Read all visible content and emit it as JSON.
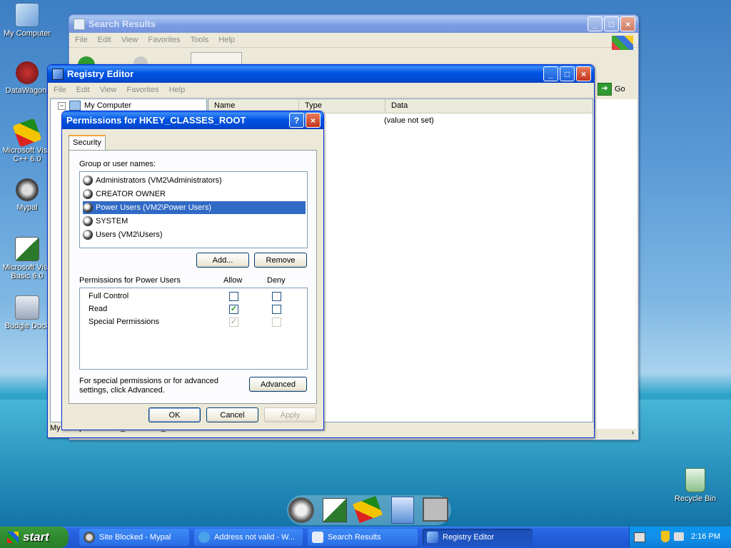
{
  "desktop": {
    "icons": [
      {
        "label": "My Computer"
      },
      {
        "label": "DataWagon."
      },
      {
        "label": "Microsoft Visu C++ 6.0"
      },
      {
        "label": "Mypal"
      },
      {
        "label": "Microsoft Visu Basic 6.0"
      },
      {
        "label": "Budgie Dock"
      },
      {
        "label": "Recycle Bin"
      }
    ]
  },
  "search_window": {
    "title": "Search Results",
    "menu": [
      "File",
      "Edit",
      "View",
      "Favorites",
      "Tools",
      "Help"
    ],
    "go_label": "Go"
  },
  "registry_window": {
    "title": "Registry Editor",
    "menu": [
      "File",
      "Edit",
      "View",
      "Favorites",
      "Help"
    ],
    "tree_root": "My Computer",
    "columns": [
      "Name",
      "Type",
      "Data"
    ],
    "row_data": "(value not set)",
    "status": "My Computer\\HKEY_CLASSES_ROOT"
  },
  "dialog": {
    "title": "Permissions for HKEY_CLASSES_ROOT",
    "help_glyph": "?",
    "tab": "Security",
    "group_label": "Group or user names:",
    "users": [
      {
        "name": "Administrators (VM2\\Administrators)",
        "selected": false
      },
      {
        "name": "CREATOR OWNER",
        "selected": false
      },
      {
        "name": "Power Users (VM2\\Power Users)",
        "selected": true
      },
      {
        "name": "SYSTEM",
        "selected": false
      },
      {
        "name": "Users (VM2\\Users)",
        "selected": false
      }
    ],
    "add_label": "Add...",
    "remove_label": "Remove",
    "perm_header": "Permissions for Power Users",
    "allow_header": "Allow",
    "deny_header": "Deny",
    "permissions": [
      {
        "name": "Full Control",
        "allow": false,
        "deny": false,
        "dim": false
      },
      {
        "name": "Read",
        "allow": true,
        "deny": false,
        "dim": false
      },
      {
        "name": "Special Permissions",
        "allow": true,
        "deny": false,
        "dim": true
      }
    ],
    "advanced_text": "For special permissions or for advanced settings, click Advanced.",
    "advanced_label": "Advanced",
    "ok_label": "OK",
    "cancel_label": "Cancel",
    "apply_label": "Apply"
  },
  "taskbar": {
    "start_label": "start",
    "tasks": [
      {
        "label": "Site Blocked - Mypal",
        "active": false
      },
      {
        "label": "Address not valid - W...",
        "active": false
      },
      {
        "label": "Search Results",
        "active": false
      },
      {
        "label": "Registry Editor",
        "active": true
      }
    ],
    "clock": "2:16 PM"
  },
  "colors": {
    "xp_blue": "#0054e3",
    "selection": "#316ac5",
    "start_green": "#2f8a2f"
  }
}
